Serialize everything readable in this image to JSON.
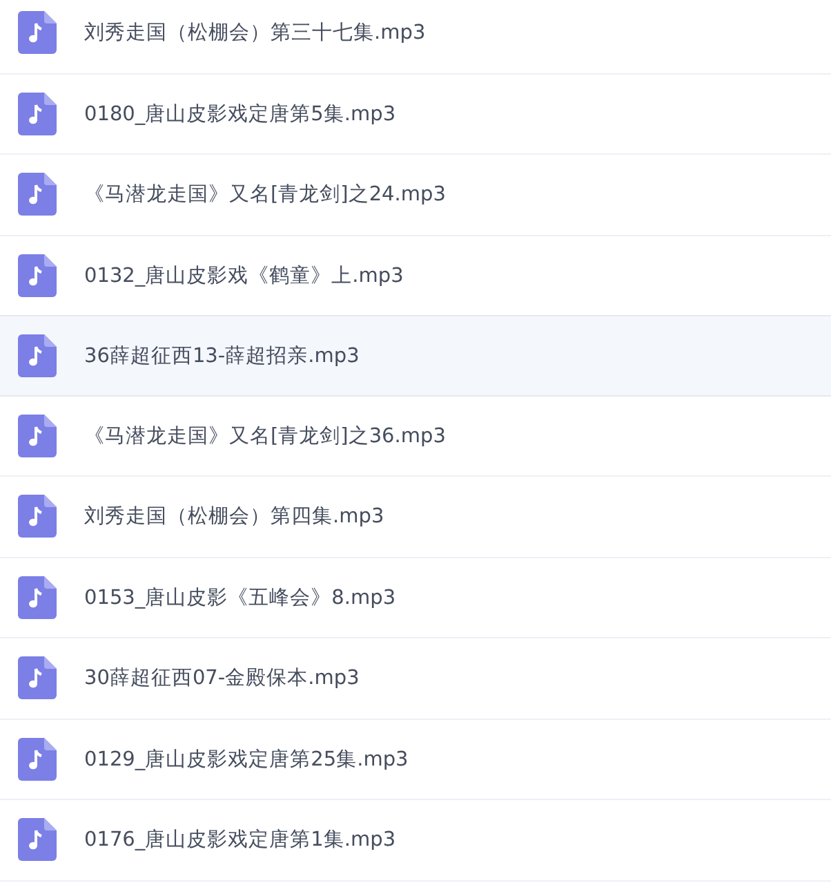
{
  "files": [
    {
      "name": "刘秀走国（松棚会）第三十七集.mp3",
      "selected": false
    },
    {
      "name": "0180_唐山皮影戏定唐第5集.mp3",
      "selected": false
    },
    {
      "name": "《马潜龙走国》又名[青龙剑]之24.mp3",
      "selected": false
    },
    {
      "name": "0132_唐山皮影戏《鹤童》上.mp3",
      "selected": false
    },
    {
      "name": "36薛超征西13-薛超招亲.mp3",
      "selected": true
    },
    {
      "name": "《马潜龙走国》又名[青龙剑]之36.mp3",
      "selected": false
    },
    {
      "name": "刘秀走国（松棚会）第四集.mp3",
      "selected": false
    },
    {
      "name": "0153_唐山皮影《五峰会》8.mp3",
      "selected": false
    },
    {
      "name": "30薛超征西07-金殿保本.mp3",
      "selected": false
    },
    {
      "name": "0129_唐山皮影戏定唐第25集.mp3",
      "selected": false
    },
    {
      "name": "0176_唐山皮影戏定唐第1集.mp3",
      "selected": false
    }
  ]
}
